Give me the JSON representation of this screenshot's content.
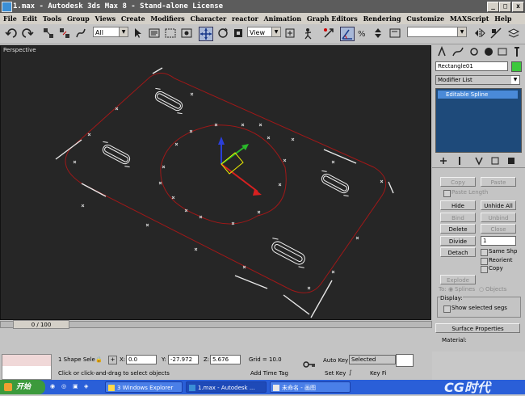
{
  "window": {
    "title": "1.max  - Autodesk 3ds Max 8  - Stand-alone License",
    "min": "_",
    "max": "□",
    "close": "x"
  },
  "menu": [
    "File",
    "Edit",
    "Tools",
    "Group",
    "Views",
    "Create",
    "Modifiers",
    "Character",
    "reactor",
    "Animation",
    "Graph Editors",
    "Rendering",
    "Customize",
    "MAXScript",
    "Help"
  ],
  "toolbar": {
    "selection_filter": "All",
    "reference_coord": "View"
  },
  "viewport": {
    "label": "Perspective"
  },
  "command_panel": {
    "object_name": "Rectangle01",
    "object_color": "#3cc83c",
    "modifier_list": "Modifier List",
    "stack_item": "Editable Spline",
    "buttons": {
      "copy": "Copy",
      "paste": "Paste",
      "paste_length": "Paste Length",
      "hide": "Hide",
      "unhide_all": "Unhide All",
      "bind": "Bind",
      "unbind": "Unbind",
      "delete": "Delete",
      "close": "Close",
      "divide": "Divide",
      "divide_value": "1",
      "detach": "Detach",
      "same_shp": "Same Shp",
      "reorient": "Reorient",
      "copy_chk": "Copy",
      "explode": "Explode",
      "to": "To:",
      "splines": "Splines",
      "objects": "Objects"
    },
    "display_label": "Display:",
    "show_selected": "Show selected segs",
    "surface_properties": "Surface Properties",
    "material": "Material:"
  },
  "status": {
    "frame": "0 / 100",
    "selection": "1 Shape Sele",
    "x_label": "X:",
    "x": "0.0",
    "y_label": "Y:",
    "y": "-27.972",
    "z_label": "Z:",
    "z": "5.676",
    "grid": "Grid = 10.0",
    "prompt": "Click or click-and-drag to select objects",
    "add_time_tag": "Add Time Tag",
    "auto_key": "Auto Key",
    "selected": "Selected",
    "set_key": "Set Key",
    "key_filters": "Key Fi"
  },
  "taskbar": {
    "start": "开始",
    "items": [
      "3 Windows Explorer",
      "1.max  - Autodesk ...",
      "未命名 - 画图"
    ],
    "watermark": "CG时代"
  }
}
